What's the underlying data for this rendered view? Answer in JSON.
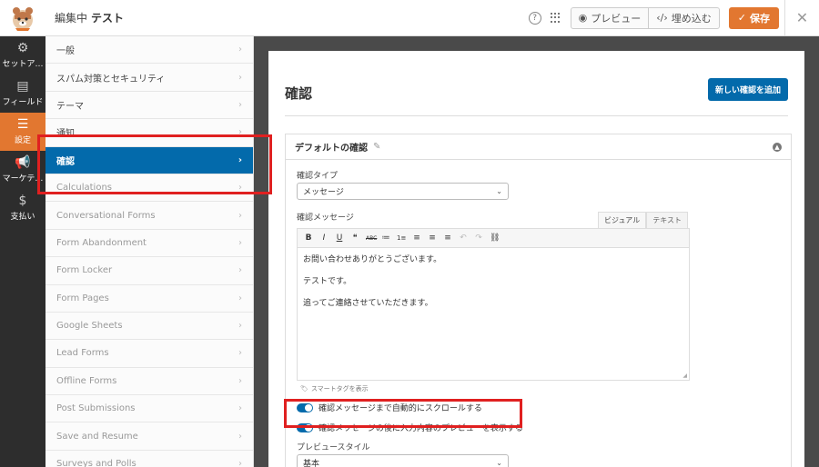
{
  "topbar": {
    "prefix": "編集中",
    "form_name": "テスト",
    "help_label": "?",
    "preview_label": "プレビュー",
    "embed_label": "埋め込む",
    "save_label": "保存",
    "close_label": "✕"
  },
  "leftnav": {
    "items": [
      {
        "label": "セットア…",
        "icon": "gear-icon"
      },
      {
        "label": "フィールド",
        "icon": "fields-icon"
      },
      {
        "label": "設定",
        "icon": "sliders-icon"
      },
      {
        "label": "マーケテ…",
        "icon": "megaphone-icon"
      },
      {
        "label": "支払い",
        "icon": "dollar-icon"
      }
    ],
    "active_index": 2
  },
  "settings_panel": {
    "items": [
      {
        "label": "一般"
      },
      {
        "label": "スパム対策とセキュリティ"
      },
      {
        "label": "テーマ"
      },
      {
        "label": "通知"
      },
      {
        "label": "確認"
      },
      {
        "label": "Calculations"
      },
      {
        "label": "Conversational Forms"
      },
      {
        "label": "Form Abandonment"
      },
      {
        "label": "Form Locker"
      },
      {
        "label": "Form Pages"
      },
      {
        "label": "Google Sheets"
      },
      {
        "label": "Lead Forms"
      },
      {
        "label": "Offline Forms"
      },
      {
        "label": "Post Submissions"
      },
      {
        "label": "Save and Resume"
      },
      {
        "label": "Surveys and Polls"
      }
    ],
    "active_index": 4
  },
  "content": {
    "title": "確認",
    "add_button": "新しい確認を追加",
    "box_title": "デフォルトの確認",
    "type_label": "確認タイプ",
    "type_value": "メッセージ",
    "message_label": "確認メッセージ",
    "tab_visual": "ビジュアル",
    "tab_text": "テキスト",
    "toolbar": [
      "B",
      "I",
      "U",
      "❝",
      "ABC",
      "≔",
      "1≡",
      "≡",
      "≡",
      "≡",
      "↶",
      "↷",
      "⛓"
    ],
    "message_lines": [
      "お問い合わせありがとうございます。",
      "テストです。",
      "追ってご連絡させていただきます。"
    ],
    "smart_tag": "スマートタグを表示",
    "toggle_scroll": "確認メッセージまで自動的にスクロールする",
    "toggle_preview": "確認メッセージの後に入力内容のプレビューを表示する",
    "preview_style_label": "プレビュースタイル",
    "preview_style_value": "基本"
  },
  "colors": {
    "accent_orange": "#e27730",
    "active_blue": "#036aab",
    "highlight_red": "#e02020",
    "nav_dark": "#2d2d2d"
  }
}
